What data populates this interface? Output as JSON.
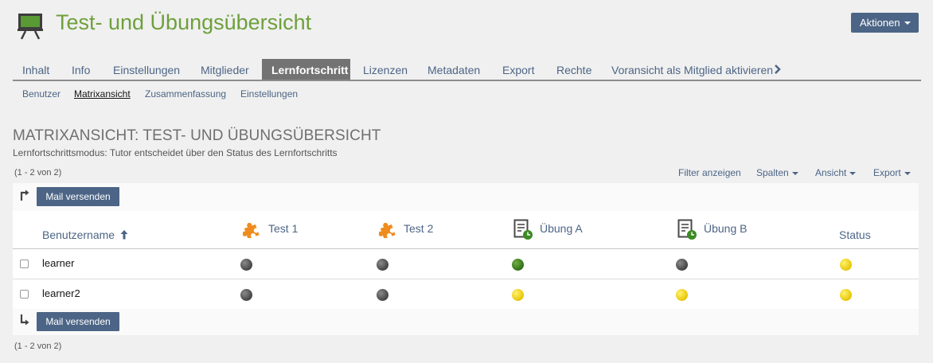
{
  "header": {
    "title": "Test- und Übungsübersicht",
    "actions_label": "Aktionen"
  },
  "tabs": [
    {
      "label": "Inhalt"
    },
    {
      "label": "Info"
    },
    {
      "label": "Einstellungen"
    },
    {
      "label": "Mitglieder"
    },
    {
      "label": "Lernfortschritt",
      "active": true
    },
    {
      "label": "Lizenzen"
    },
    {
      "label": "Metadaten"
    },
    {
      "label": "Export"
    },
    {
      "label": "Rechte"
    },
    {
      "label": "Voransicht als Mitglied aktivieren"
    }
  ],
  "subtabs": [
    {
      "label": "Benutzer"
    },
    {
      "label": "Matrixansicht",
      "active": true
    },
    {
      "label": "Zusammenfassung"
    },
    {
      "label": "Einstellungen"
    }
  ],
  "section": {
    "title": "MATRIXANSICHT: TEST- UND ÜBUNGSÜBERSICHT",
    "mode": "Lernfortschrittsmodus: Tutor entscheidet über den Status des Lernfortschritts"
  },
  "range_text": "(1 - 2 von 2)",
  "controls": {
    "filter": "Filter anzeigen",
    "columns": "Spalten",
    "view": "Ansicht",
    "export": "Export"
  },
  "mail_label": "Mail versenden",
  "table": {
    "columns": {
      "username": "Benutzername",
      "test1": "Test 1",
      "test2": "Test 2",
      "uebung_a": "Übung A",
      "uebung_b": "Übung B",
      "status": "Status"
    },
    "rows": [
      {
        "name": "learner",
        "cells": [
          "grey",
          "grey",
          "green",
          "grey",
          "yellow"
        ]
      },
      {
        "name": "learner2",
        "cells": [
          "grey",
          "grey",
          "yellow",
          "yellow",
          "yellow"
        ]
      }
    ]
  },
  "colors": {
    "brand_green": "#6ea03c",
    "link_blue": "#4c6586",
    "status_grey": "#555555",
    "status_green": "#3d7f1f",
    "status_yellow": "#f5db1e"
  },
  "icons": {
    "title": "blackboard-icon",
    "test": "puzzle-icon",
    "uebung": "exercise-clock-icon"
  }
}
